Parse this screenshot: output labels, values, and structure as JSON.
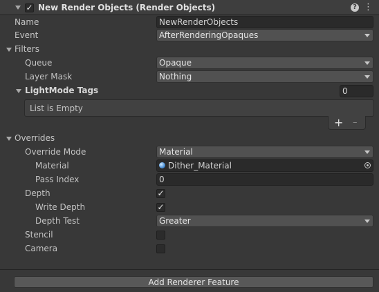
{
  "header": {
    "title": "New Render Objects (Render Objects)",
    "enabled": true,
    "help_icon": "help-icon",
    "settings_icon": "gear-icon"
  },
  "fields": {
    "name_label": "Name",
    "name_value": "NewRenderObjects",
    "event_label": "Event",
    "event_value": "AfterRenderingOpaques"
  },
  "filters": {
    "section_label": "Filters",
    "queue_label": "Queue",
    "queue_value": "Opaque",
    "layer_mask_label": "Layer Mask",
    "layer_mask_value": "Nothing",
    "lightmode_label": "LightMode Tags",
    "lightmode_count": "0",
    "list_empty": "List is Empty",
    "add_symbol": "+",
    "remove_symbol": "–"
  },
  "overrides": {
    "section_label": "Overrides",
    "override_mode_label": "Override Mode",
    "override_mode_value": "Material",
    "material_label": "Material",
    "material_value": "Dither_Material",
    "pass_index_label": "Pass Index",
    "pass_index_value": "0",
    "depth_label": "Depth",
    "depth_checked": true,
    "write_depth_label": "Write Depth",
    "write_depth_checked": true,
    "depth_test_label": "Depth Test",
    "depth_test_value": "Greater",
    "stencil_label": "Stencil",
    "stencil_checked": false,
    "camera_label": "Camera",
    "camera_checked": false
  },
  "footer": {
    "add_renderer_feature": "Add Renderer Feature"
  },
  "colors": {
    "background": "#383838",
    "field": "#2a2a2a",
    "dropdown": "#515151",
    "text": "#c4c4c4"
  }
}
